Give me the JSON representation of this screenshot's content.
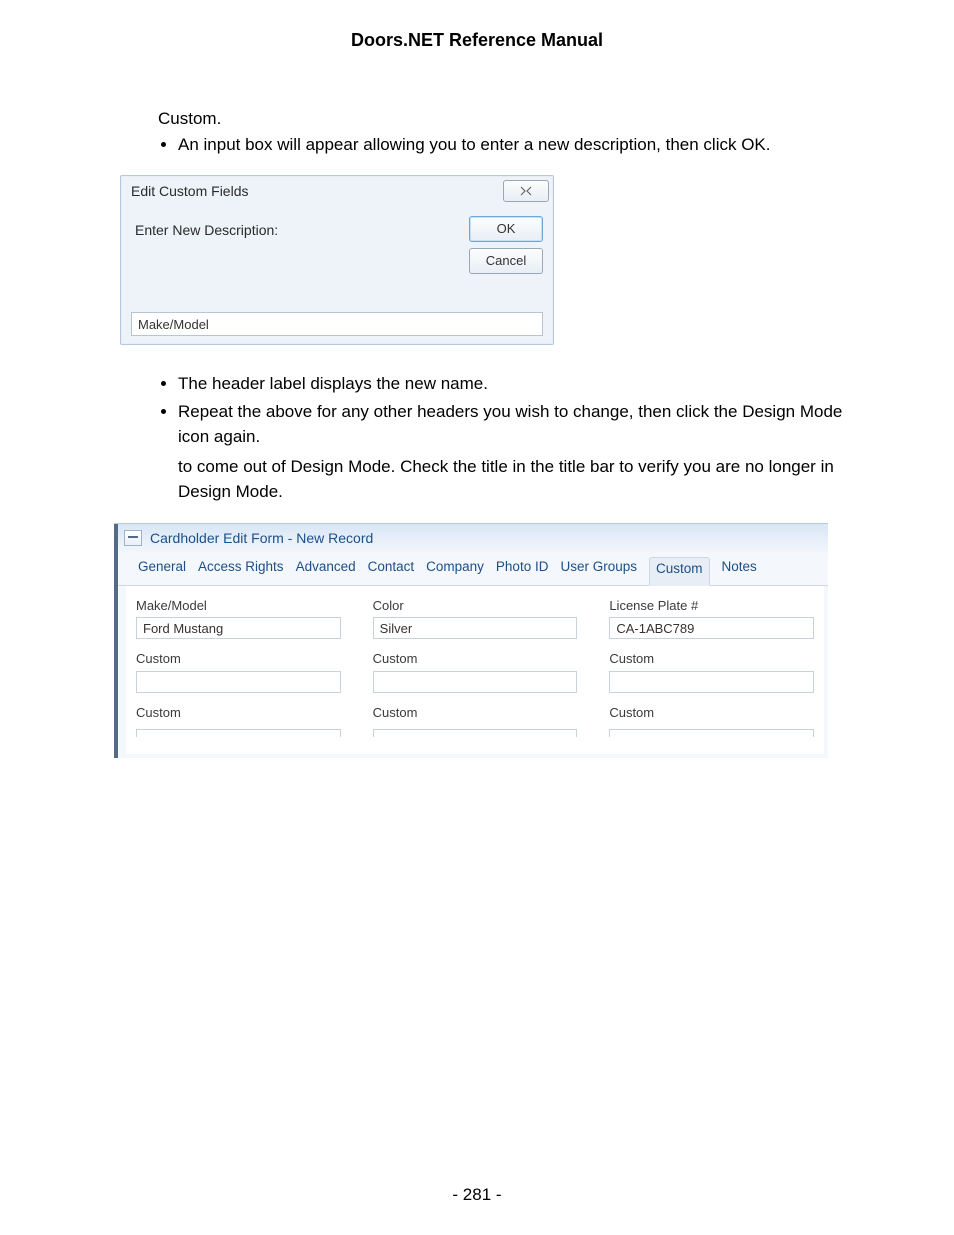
{
  "page_title": "Doors.NET Reference Manual",
  "page_number": "- 281 -",
  "body": {
    "lead_in": "Custom.",
    "bullet1": "An input box will appear allowing you to enter a new description, then click OK.",
    "bullet2": "The header label displays the new name.",
    "bullet3": "Repeat the above for any other headers you wish to change, then click the Design Mode icon again.",
    "followup": "to come out of Design Mode. Check the title in the title bar to verify you are no longer in Design Mode."
  },
  "dialog": {
    "title": "Edit Custom Fields",
    "close_glyph": "✕",
    "prompt": "Enter New Description:",
    "ok_label": "OK",
    "cancel_label": "Cancel",
    "input_value": "Make/Model"
  },
  "form": {
    "title": "Cardholder Edit Form - New Record",
    "tabs": [
      "General",
      "Access Rights",
      "Advanced",
      "Contact",
      "Company",
      "Photo ID",
      "User Groups",
      "Custom",
      "Notes"
    ],
    "active_tab_index": 7,
    "fields_row1": [
      {
        "label": "Make/Model",
        "value": "Ford Mustang"
      },
      {
        "label": "Color",
        "value": "Silver"
      },
      {
        "label": "License Plate #",
        "value": "CA-1ABC789"
      }
    ],
    "fields_row2": [
      {
        "label": "Custom",
        "value": ""
      },
      {
        "label": "Custom",
        "value": ""
      },
      {
        "label": "Custom",
        "value": ""
      }
    ],
    "fields_row3": [
      {
        "label": "Custom",
        "value": ""
      },
      {
        "label": "Custom",
        "value": ""
      },
      {
        "label": "Custom",
        "value": ""
      }
    ]
  }
}
